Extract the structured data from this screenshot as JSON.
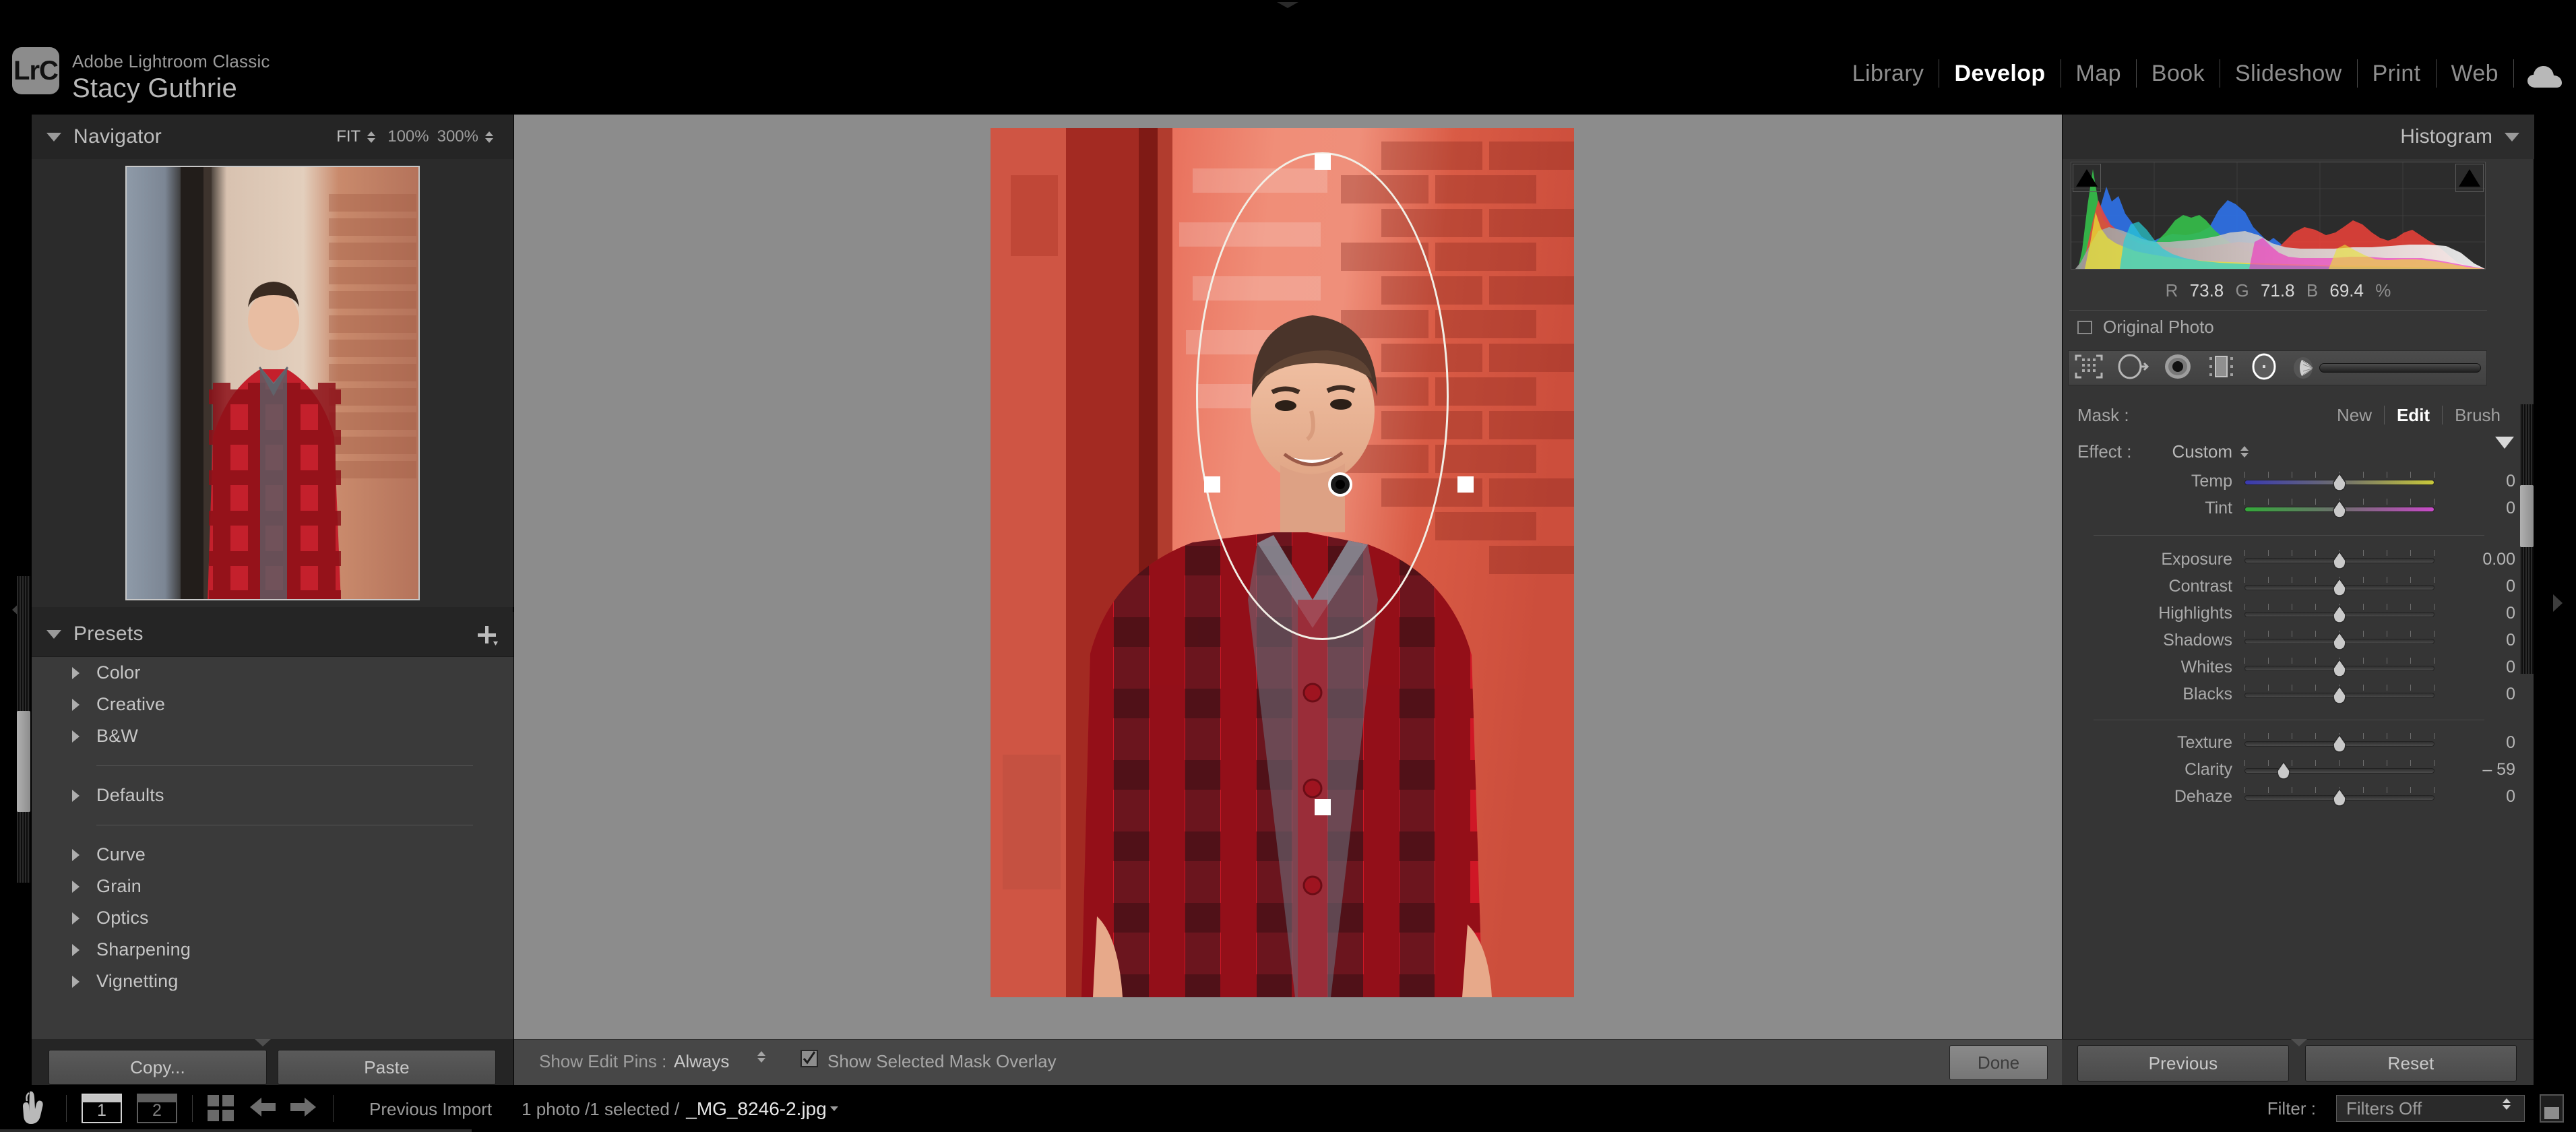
{
  "identity": {
    "logo_text": "LrC",
    "app_name": "Adobe Lightroom Classic",
    "user_name": "Stacy Guthrie",
    "cloud_icon": "cloud-icon"
  },
  "modules": [
    {
      "label": "Library",
      "active": false
    },
    {
      "label": "Develop",
      "active": true
    },
    {
      "label": "Map",
      "active": false
    },
    {
      "label": "Book",
      "active": false
    },
    {
      "label": "Slideshow",
      "active": false
    },
    {
      "label": "Print",
      "active": false
    },
    {
      "label": "Web",
      "active": false
    }
  ],
  "navigator": {
    "title": "Navigator",
    "zoom_fit": "FIT",
    "zoom_100": "100%",
    "zoom_300": "300%"
  },
  "presets": {
    "title": "Presets",
    "add_icon": "plus-icon",
    "groups": [
      {
        "label": "Color"
      },
      {
        "label": "Creative"
      },
      {
        "label": "B&W"
      },
      {
        "separator": true
      },
      {
        "label": "Defaults"
      },
      {
        "separator": true
      },
      {
        "label": "Curve"
      },
      {
        "label": "Grain"
      },
      {
        "label": "Optics"
      },
      {
        "label": "Sharpening"
      },
      {
        "label": "Vignetting"
      }
    ]
  },
  "left_footer": {
    "copy_label": "Copy...",
    "paste_label": "Paste"
  },
  "center_toolbar": {
    "show_edit_pins_label": "Show Edit Pins :",
    "show_edit_pins_value": "Always",
    "mask_overlay_label": "Show Selected Mask Overlay",
    "mask_overlay_checked": true,
    "done_label": "Done"
  },
  "histogram": {
    "title": "Histogram",
    "r_label": "R",
    "r_value": "73.8",
    "g_label": "G",
    "g_value": "71.8",
    "b_label": "B",
    "b_value": "69.4",
    "percent": "%",
    "original_photo_label": "Original Photo"
  },
  "mask_tools": [
    {
      "name": "auto-select-subject-icon"
    },
    {
      "name": "select-objects-icon"
    },
    {
      "name": "select-sky-icon"
    },
    {
      "name": "linear-gradient-icon"
    },
    {
      "name": "radial-gradient-icon"
    },
    {
      "name": "brush-icon"
    }
  ],
  "mask": {
    "label": "Mask :",
    "actions": [
      {
        "label": "New",
        "active": false
      },
      {
        "label": "Edit",
        "active": true
      },
      {
        "label": "Brush",
        "active": false
      }
    ]
  },
  "effect": {
    "label": "Effect :",
    "value": "Custom"
  },
  "sliders_wb": [
    {
      "name": "Temp",
      "value": "0",
      "pos": 50,
      "track": "temp"
    },
    {
      "name": "Tint",
      "value": "0",
      "pos": 50,
      "track": "tint"
    }
  ],
  "sliders_tone": [
    {
      "name": "Exposure",
      "value": "0.00",
      "pos": 50
    },
    {
      "name": "Contrast",
      "value": "0",
      "pos": 50
    },
    {
      "name": "Highlights",
      "value": "0",
      "pos": 50
    },
    {
      "name": "Shadows",
      "value": "0",
      "pos": 50
    },
    {
      "name": "Whites",
      "value": "0",
      "pos": 50
    },
    {
      "name": "Blacks",
      "value": "0",
      "pos": 50
    }
  ],
  "sliders_presence": [
    {
      "name": "Texture",
      "value": "0",
      "pos": 50
    },
    {
      "name": "Clarity",
      "value": "– 59",
      "pos": 20.5
    },
    {
      "name": "Dehaze",
      "value": "0",
      "pos": 50
    }
  ],
  "right_footer": {
    "previous_label": "Previous",
    "reset_label": "Reset"
  },
  "status_bar": {
    "hand_icon": "hand-icon",
    "screen_one": "1",
    "screen_two": "2",
    "grid_icon": "grid-icon",
    "back_icon": "arrow-left-icon",
    "forward_icon": "arrow-right-icon",
    "source": "Previous Import",
    "count": "1 photo /1 selected /",
    "photo_name": "_MG_8246-2.jpg",
    "filter_label": "Filter :",
    "filter_value": "Filters Off"
  },
  "colors": {
    "panel_bg": "#353535",
    "left_panel_bg": "#252525",
    "stage_bg": "#8c8c8c",
    "accent_white": "#ffffff",
    "mask_overlay_red": "#e03024"
  }
}
